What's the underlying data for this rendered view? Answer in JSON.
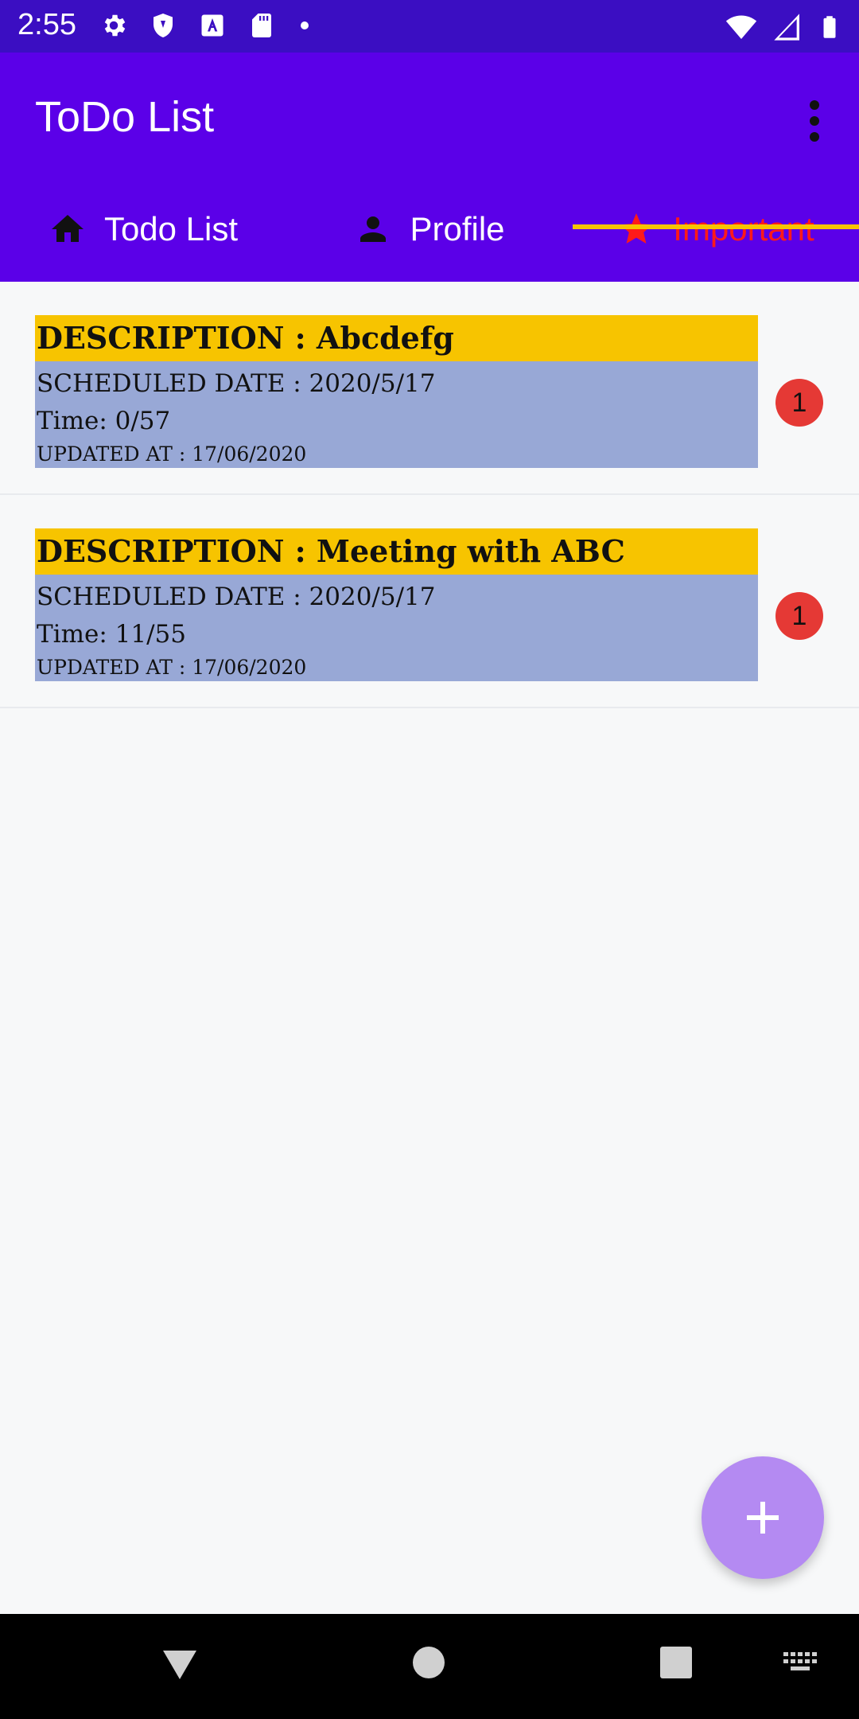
{
  "status_bar": {
    "time": "2:55",
    "left_icons": [
      "settings-icon",
      "shield-icon",
      "font-a-icon",
      "sd-card-icon",
      "dot-icon"
    ],
    "right_icons": [
      "wifi-icon",
      "cellular-signal-icon",
      "battery-icon"
    ]
  },
  "app_bar": {
    "title": "ToDo List",
    "overflow_icon": "more-vert-icon",
    "color": "#5b00e8"
  },
  "tabs": [
    {
      "label": "Todo List",
      "icon": "home-icon",
      "active": false
    },
    {
      "label": "Profile",
      "icon": "person-icon",
      "active": false
    },
    {
      "label": "Important",
      "icon": "star-icon",
      "active": true
    }
  ],
  "todos": [
    {
      "description": "DESCRIPTION : Abcdefg",
      "scheduled_date": "SCHEDULED DATE : 2020/5/17",
      "time": "Time: 0/57",
      "updated_at": "UPDATED AT : 17/06/2020",
      "priority": "1"
    },
    {
      "description": "DESCRIPTION : Meeting with ABC",
      "scheduled_date": "SCHEDULED DATE : 2020/5/17",
      "time": "Time: 11/55",
      "updated_at": "UPDATED AT : 17/06/2020",
      "priority": "1"
    }
  ],
  "fab": {
    "icon": "plus-icon",
    "color": "#b48af2"
  },
  "colors": {
    "accent_yellow": "#f7c400",
    "card_body": "#98a8d6",
    "active_tab_text": "#ff1a1a",
    "badge_red": "#e53935"
  },
  "nav_bar": {
    "icons": [
      "back-icon",
      "home-circle-icon",
      "recents-icon",
      "keyboard-icon"
    ]
  }
}
